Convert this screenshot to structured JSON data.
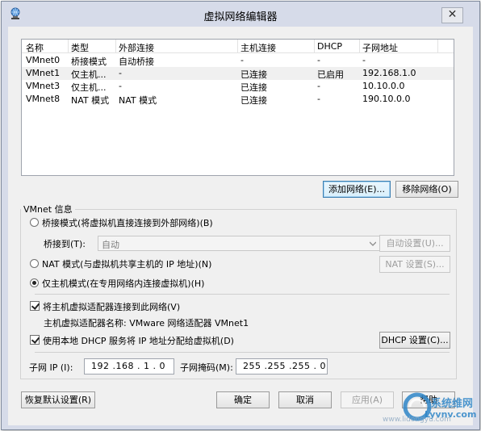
{
  "window": {
    "title": "虚拟网络编辑器",
    "close_glyph": "✕"
  },
  "list": {
    "columns": [
      "名称",
      "类型",
      "外部连接",
      "主机连接",
      "DHCP",
      "子网地址"
    ],
    "rows": [
      [
        "VMnet0",
        "桥接模式",
        "自动桥接",
        "-",
        "-",
        "-"
      ],
      [
        "VMnet1",
        "仅主机...",
        "-",
        "已连接",
        "已启用",
        "192.168.1.0"
      ],
      [
        "VMnet3",
        "仅主机...",
        "-",
        "已连接",
        "-",
        "10.10.0.0"
      ],
      [
        "VMnet8",
        "NAT 模式",
        "NAT 模式",
        "已连接",
        "-",
        "190.10.0.0"
      ]
    ],
    "selected_row": 1
  },
  "buttons": {
    "add_network": "添加网络(E)...",
    "remove_network": "移除网络(O)"
  },
  "vmnet_info": {
    "group_title": "VMnet 信息",
    "bridged_mode": "桥接模式(将虚拟机直接连接到外部网络)(B)",
    "bridged_to_label": "桥接到(T):",
    "bridged_to_value": "自动",
    "auto_settings": "自动设置(U)...",
    "nat_mode": "NAT 模式(与虚拟机共享主机的 IP 地址)(N)",
    "nat_settings": "NAT 设置(S)...",
    "host_only_mode": "仅主机模式(在专用网络内连接虚拟机)(H)",
    "selected_mode": "host_only",
    "connect_host_adapter": "将主机虚拟适配器连接到此网络(V)",
    "connect_host_adapter_checked": true,
    "adapter_name_text": "主机虚拟适配器名称: VMware 网络适配器 VMnet1",
    "use_dhcp": "使用本地 DHCP 服务将 IP 地址分配给虚拟机(D)",
    "use_dhcp_checked": true,
    "dhcp_settings": "DHCP 设置(C)...",
    "subnet_ip_label": "子网 IP (I):",
    "subnet_ip_value": "192 .168 . 1  . 0",
    "subnet_mask_label": "子网掩码(M):",
    "subnet_mask_value": "255 .255 .255 . 0"
  },
  "footer": {
    "restore_defaults": "恢复默认设置(R)",
    "ok": "确定",
    "cancel": "取消",
    "apply": "应用(A)",
    "help": "帮助"
  },
  "watermark": {
    "site_name": "系统维网",
    "site_url": "www.lidongyu.com",
    "brand": "Lyvnv.com"
  },
  "colors": {
    "window_frame": "#d6dbe9",
    "client_bg": "#f0f0f0",
    "focus_border": "#3c7fb1",
    "watermark_blue": "#2f86c8"
  },
  "icons": {
    "app": "network-globe-icon",
    "close": "close-icon",
    "dropdown": "chevron-down-icon"
  }
}
